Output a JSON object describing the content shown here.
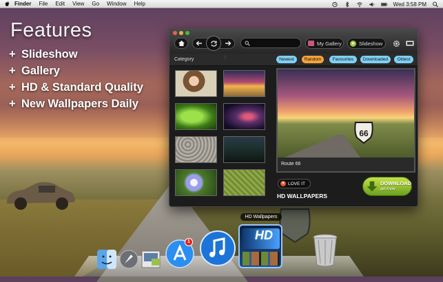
{
  "menubar": {
    "items": [
      "Finder",
      "File",
      "Edit",
      "View",
      "Go",
      "Window",
      "Help"
    ],
    "clock": "Wed 3:58 PM"
  },
  "features": {
    "title": "Features",
    "items": [
      "Slideshow",
      "Gallery",
      "HD & Standard Quality",
      "New Wallpapers Daily"
    ],
    "bullet": "+"
  },
  "app": {
    "toolbar": {
      "my_gallery_label": "My Gallery",
      "slideshow_label": "Slideshow",
      "search_placeholder": ""
    },
    "category_label": "Category",
    "filters": [
      "Newest",
      "Random",
      "Favourites",
      "Downloaded",
      "Oldest"
    ],
    "preview_caption": "Route 66",
    "love_label": "LOVE IT",
    "brand": "HD WALLPAPERS",
    "download_label": "DOWNLOAD",
    "download_sub": "get it now",
    "sign_text": "66"
  },
  "dock": {
    "tooltip": "HD Wallpapers",
    "appstore_badge": "1",
    "hd_label": "HD",
    "icons": [
      "finder-icon",
      "launchpad-icon",
      "preview-icon",
      "app-store-icon",
      "itunes-icon",
      "hd-wallpapers-icon",
      "trash-icon"
    ]
  },
  "colors": {
    "filter_blue": "#7fd0f4",
    "filter_orange": "#f5a33a",
    "download_green": "#8fc232"
  }
}
